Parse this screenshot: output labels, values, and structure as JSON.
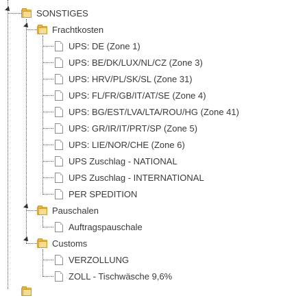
{
  "tree": {
    "root": {
      "label": "SONSTIGES",
      "icon": "folder-icon"
    },
    "groups": [
      {
        "label": "Frachtkosten",
        "icon": "folder-icon",
        "items": [
          "UPS: DE (Zone 1)",
          "UPS: BE/DK/LUX/NL/CZ (Zone 3)",
          "UPS: HRV/PL/SK/SL (Zone 31)",
          "UPS: FL/FR/GB/IT/AT/SE (Zone 4)",
          "UPS: BG/EST/LVA/LTA/ROU/HG (Zone 41)",
          "UPS: GR/IR/IT/PRT/SP (Zone 5)",
          "UPS: LIE/NOR/CHE (Zone 6)",
          "UPS Zuschlag - NATIONAL",
          "UPS Zuschlag - INTERNATIONAL",
          "PER SPEDITION"
        ]
      },
      {
        "label": "Pauschalen",
        "icon": "folder-icon",
        "items": [
          "Auftragspauschale"
        ]
      },
      {
        "label": "Customs",
        "icon": "folder-icon",
        "items": [
          "VERZOLLUNG",
          "ZOLL - Tischwäsche 9,6%"
        ]
      }
    ]
  }
}
